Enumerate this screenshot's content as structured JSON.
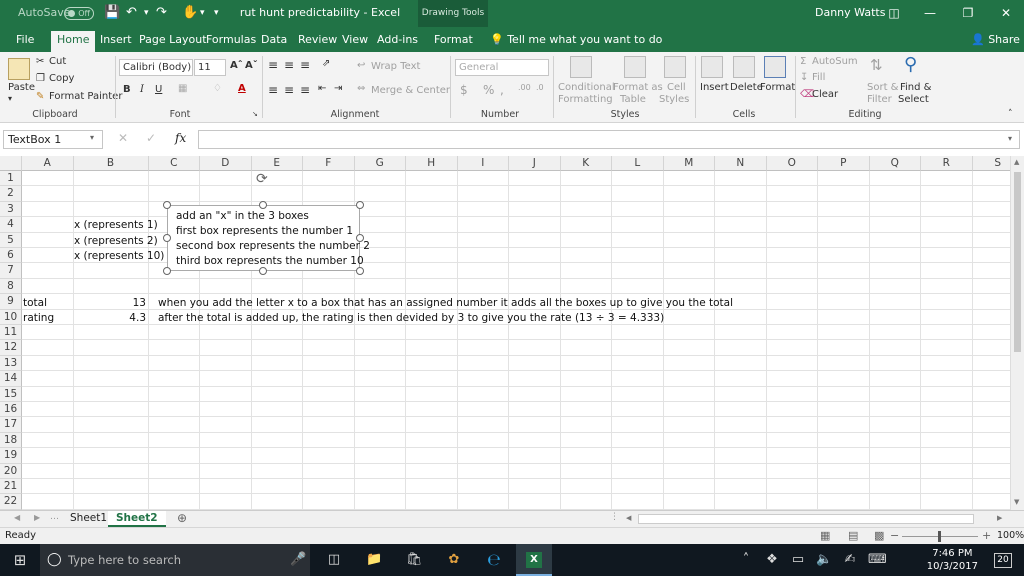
{
  "titlebar": {
    "autosave_label": "AutoSave",
    "autosave_state": "Off",
    "document_title": "rut hunt predictability  -  Excel",
    "context_tab_group": "Drawing Tools",
    "user_name": "Danny Watts"
  },
  "tabs": [
    "File",
    "Home",
    "Insert",
    "Page Layout",
    "Formulas",
    "Data",
    "Review",
    "View",
    "Add-ins",
    "Format"
  ],
  "tell_me": "Tell me what you want to do",
  "share": "Share",
  "ribbon": {
    "clipboard": {
      "paste": "Paste",
      "cut": "Cut",
      "copy": "Copy",
      "format_painter": "Format Painter",
      "label": "Clipboard"
    },
    "font": {
      "name": "Calibri (Body)",
      "size": "11",
      "label": "Font"
    },
    "alignment": {
      "wrap_text": "Wrap Text",
      "merge_center": "Merge & Center",
      "label": "Alignment"
    },
    "number": {
      "format": "General",
      "label": "Number"
    },
    "styles": {
      "conditional": "Conditional",
      "conditional2": "Formatting",
      "format_as": "Format as",
      "format_as2": "Table",
      "cell": "Cell",
      "cell2": "Styles",
      "label": "Styles"
    },
    "cells": {
      "insert": "Insert",
      "delete": "Delete",
      "format": "Format",
      "label": "Cells"
    },
    "editing": {
      "autosum": "AutoSum",
      "fill": "Fill",
      "clear": "Clear",
      "sort": "Sort &",
      "sort2": "Filter",
      "find": "Find &",
      "find2": "Select",
      "label": "Editing"
    }
  },
  "formula_bar": {
    "name_box": "TextBox 1",
    "fx": "fx",
    "value": ""
  },
  "columns": [
    "A",
    "B",
    "C",
    "D",
    "E",
    "F",
    "G",
    "H",
    "I",
    "J",
    "K",
    "L",
    "M",
    "N",
    "O",
    "P",
    "Q",
    "R",
    "S"
  ],
  "rows": [
    "1",
    "2",
    "3",
    "4",
    "5",
    "6",
    "7",
    "8",
    "9",
    "10",
    "11",
    "12",
    "13",
    "14",
    "15",
    "16",
    "17",
    "18",
    "19",
    "20",
    "21",
    "22"
  ],
  "cells": {
    "b4": "x (represents 1)",
    "b5": "x (represents 2)",
    "b6": "x (represents 10)",
    "a9": "total",
    "b9": "13",
    "c9": "when you add the letter x to a box that has an assigned number it adds all the boxes up to give you the total",
    "a10": "rating",
    "b10": "4.3",
    "c10": "after the total is added up, the rating is then devided by 3 to give you the rate (13 ÷ 3 = 4.333)"
  },
  "textbox": {
    "lines": [
      "add an \"x\" in the 3 boxes",
      "first box represents the number 1",
      "second box represents the number 2",
      "third box represents the number 10"
    ]
  },
  "sheets": [
    "Sheet1",
    "Sheet2"
  ],
  "status": {
    "ready": "Ready",
    "zoom": "100%"
  },
  "taskbar": {
    "search_placeholder": "Type here to search",
    "time": "7:46 PM",
    "date": "10/3/2017",
    "notifications": "20"
  }
}
